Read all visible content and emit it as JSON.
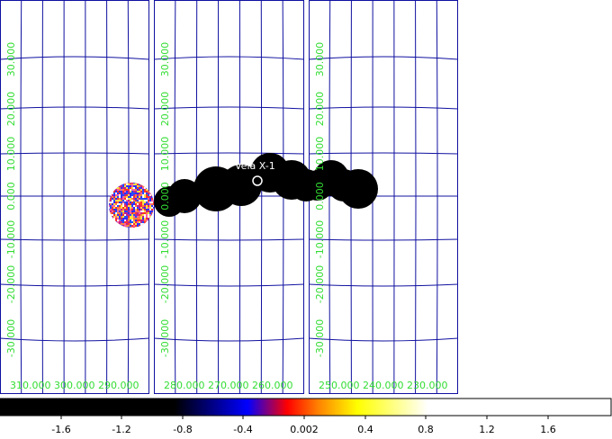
{
  "source_label": "Vela X-1",
  "panels": [
    {
      "lon_labels": [
        "310.000",
        "300.000",
        "290.000"
      ],
      "lat_labels": [
        "30.000",
        "20.000",
        "10.000",
        "0.000",
        "-10.000",
        "-20.000",
        "-30.000"
      ]
    },
    {
      "lon_labels": [
        "280.000",
        "270.000",
        "260.000"
      ],
      "lat_labels": [
        "30.000",
        "20.000",
        "10.000",
        "0.000",
        "-10.000",
        "-20.000",
        "-30.000"
      ]
    },
    {
      "lon_labels": [
        "250.000",
        "240.000",
        "230.000"
      ],
      "lat_labels": [
        "30.000",
        "20.000",
        "10.000",
        "0.000",
        "-10.000",
        "-20.000",
        "-30.000"
      ]
    }
  ],
  "colorbar": {
    "ticks": [
      "-1.6",
      "-1.2",
      "-0.8",
      "-0.4",
      "0.002",
      "0.4",
      "0.8",
      "1.2",
      "1.6"
    ],
    "colors": {
      "stop_black": "#000000",
      "stop_blue": "#0000ff",
      "stop_red": "#ff0000",
      "stop_orange": "#ff8000",
      "stop_yellow": "#ffff00",
      "stop_white": "#ffffff"
    }
  },
  "colors": {
    "grid": "#1010a0",
    "label": "#33dd33"
  }
}
